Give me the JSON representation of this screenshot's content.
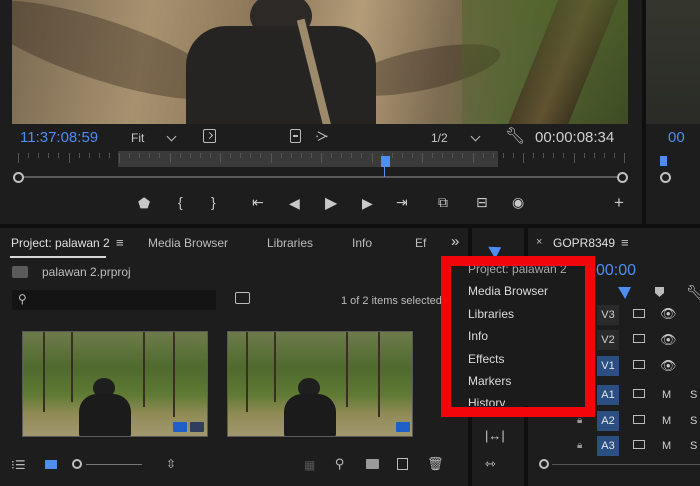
{
  "monitor": {
    "timecode_current": "11:37:08:59",
    "zoom_select": "Fit",
    "resolution_select": "1/2",
    "timecode_duration": "00:00:08:34",
    "right_timecode_partial": "00"
  },
  "project": {
    "tabs": [
      {
        "label": "Project: palawan 2"
      },
      {
        "label": "Media Browser"
      },
      {
        "label": "Libraries"
      },
      {
        "label": "Info"
      },
      {
        "label": "Ef"
      }
    ],
    "overflow": "»",
    "filename": "palawan 2.prproj",
    "search_placeholder": "",
    "items_status": "1 of 2 items selected"
  },
  "timeline": {
    "sequence_name": "GOPR8349",
    "timecode_partial": "00:00",
    "tracks": {
      "video": [
        "V3",
        "V2",
        "V1"
      ],
      "audio": [
        "A1",
        "A2",
        "A3"
      ],
      "mute": "M",
      "solo_partial": "S"
    }
  },
  "menu": {
    "items": [
      "Project: palawan 2",
      "Media Browser",
      "Libraries",
      "Info",
      "Effects",
      "Markers",
      "History"
    ]
  },
  "colors": {
    "accent_blue": "#4f8df0",
    "highlight_red": "#f2050b",
    "panel_bg": "#1d1d1d"
  }
}
